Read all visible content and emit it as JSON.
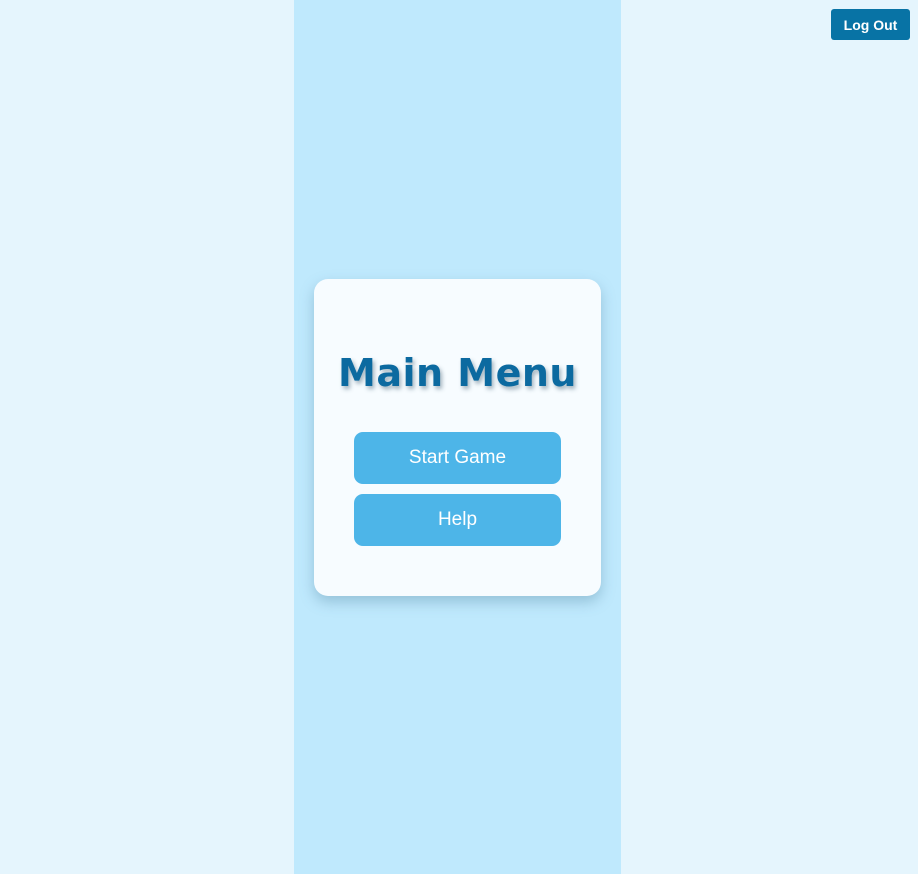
{
  "header": {
    "logout_label": "Log Out"
  },
  "menu": {
    "title": "Main Menu",
    "start_label": "Start Game",
    "help_label": "Help"
  },
  "colors": {
    "page_background": "#e5f5fd",
    "center_column": "#bfe9fd",
    "card_background": "#f7fcff",
    "title_text": "#0c6aa0",
    "menu_button": "#4db5e8",
    "logout_button": "#0873a5"
  }
}
